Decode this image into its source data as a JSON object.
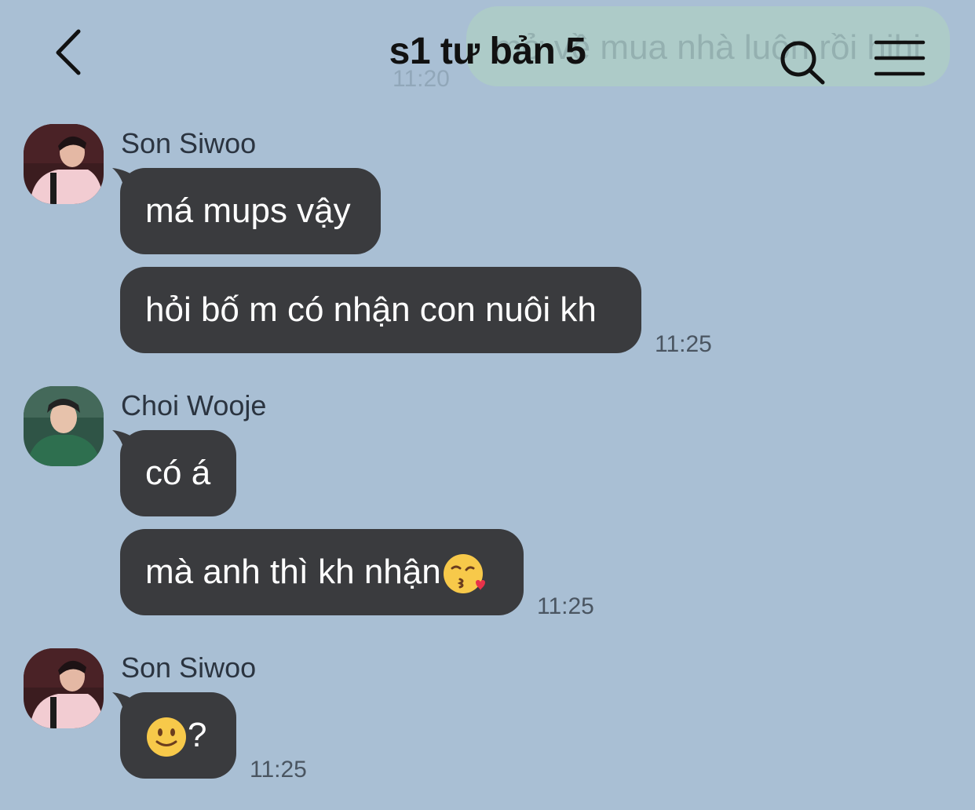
{
  "header": {
    "title": "s1 tư bản 5",
    "back_icon": "chevron-left-icon",
    "search_icon": "search-icon",
    "menu_icon": "hamburger-menu-icon"
  },
  "background_message": {
    "text": "mở về mua nhà luôn rồi hihi",
    "time": "11:20"
  },
  "colors": {
    "background": "#a9bfd4",
    "bubble": "#3a3b3e",
    "bubble_text": "#ffffff",
    "sender_text": "#2b3440",
    "time_text": "#4a5561"
  },
  "messages": [
    {
      "sender": "Son Siwoo",
      "avatar": "son-siwoo-avatar",
      "bubbles": [
        {
          "text": "má mups vậy"
        },
        {
          "text": "hỏi bố m có nhận con nuôi kh",
          "time": "11:25"
        }
      ]
    },
    {
      "sender": "Choi Wooje",
      "avatar": "choi-wooje-avatar",
      "bubbles": [
        {
          "text": "có á"
        },
        {
          "text": "mà anh thì kh nhận",
          "emoji": "kissing-heart-emoji",
          "time": "11:25"
        }
      ]
    },
    {
      "sender": "Son Siwoo",
      "avatar": "son-siwoo-avatar",
      "bubbles": [
        {
          "text": "?",
          "emoji": "slightly-smiling-face-emoji",
          "time": "11:25"
        }
      ]
    }
  ]
}
